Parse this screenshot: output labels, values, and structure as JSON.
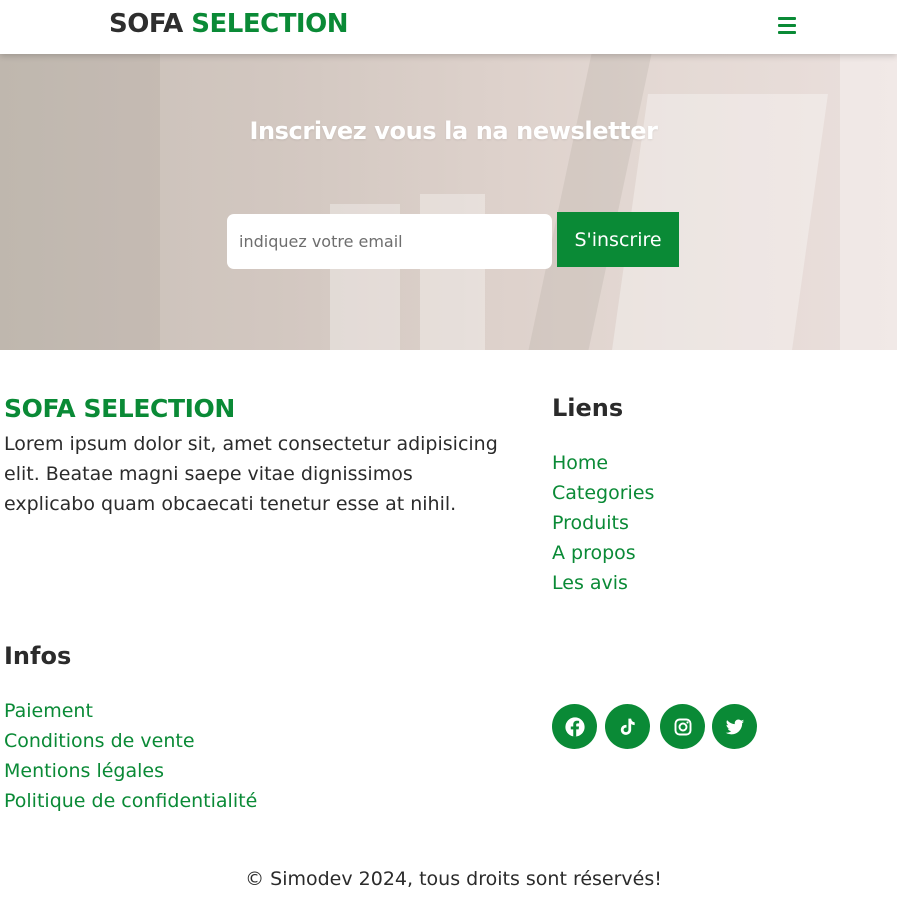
{
  "header": {
    "logo_part1": "SOFA",
    "logo_part2": "SELECTION",
    "menu_icon": "hamburger-menu-icon"
  },
  "newsletter": {
    "title": "Inscrivez vous la na newsletter",
    "email_placeholder": "indiquez votre email",
    "email_value": "",
    "subscribe_label": "S'inscrire"
  },
  "footer": {
    "brand": "SOFA SELECTION",
    "description": "Lorem ipsum dolor sit, amet consectetur adipisicing elit. Beatae magni saepe vitae dignissimos explicabo quam obcaecati tenetur esse at nihil.",
    "links_heading": "Liens",
    "links": [
      "Home",
      "Categories",
      "Produits",
      "A propos",
      "Les avis"
    ],
    "infos_heading": "Infos",
    "infos": [
      "Paiement",
      "Conditions de vente",
      "Mentions légales",
      "Politique de confidentialité"
    ],
    "socials": [
      "facebook-icon",
      "tiktok-icon",
      "instagram-icon",
      "twitter-icon"
    ],
    "copyright": "© Simodev 2024, tous droits sont réservés!"
  },
  "colors": {
    "accent": "#0a8a36",
    "text": "#2b2b2b",
    "hero_title": "#ffffff"
  }
}
